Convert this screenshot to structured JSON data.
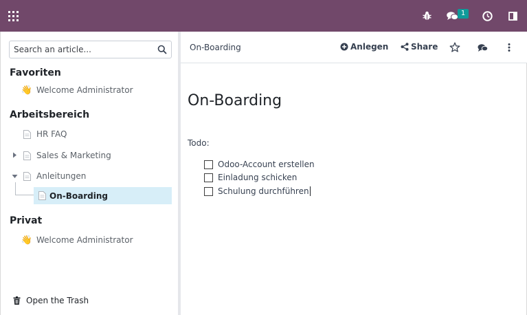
{
  "navbar": {
    "apps_icon": "apps-grid-icon",
    "bug_icon": "bug-icon",
    "chat_icon": "chat-bubbles-icon",
    "chat_badge": "1",
    "activity_icon": "clock-icon",
    "panel_icon": "sidebar-toggle-icon",
    "color": "#71486a"
  },
  "sidebar": {
    "search_placeholder": "Search an article...",
    "sections": {
      "favorites": {
        "title": "Favoriten",
        "items": [
          {
            "label": "Welcome Administrator",
            "icon": "waving-hand-icon"
          }
        ]
      },
      "workspace": {
        "title": "Arbeitsbereich",
        "items": [
          {
            "label": "HR FAQ",
            "icon": "document-icon"
          },
          {
            "label": "Sales & Marketing",
            "icon": "document-icon"
          },
          {
            "label": "Anleitungen",
            "icon": "document-icon"
          },
          {
            "label": "On-Boarding",
            "icon": "document-icon"
          }
        ]
      },
      "private": {
        "title": "Privat",
        "items": [
          {
            "label": "Welcome Administrator",
            "icon": "waving-hand-icon"
          }
        ]
      }
    },
    "trash_label": "Open the Trash"
  },
  "topbar": {
    "breadcrumb": "On-Boarding",
    "create_label": "Anlegen",
    "share_label": "Share"
  },
  "article": {
    "title": "On-Boarding",
    "todo_label": "Todo:",
    "checklist": [
      {
        "label": "Odoo-Account erstellen",
        "checked": false
      },
      {
        "label": "Einladung schicken",
        "checked": false
      },
      {
        "label": "Schulung durchführen",
        "checked": false
      }
    ]
  }
}
